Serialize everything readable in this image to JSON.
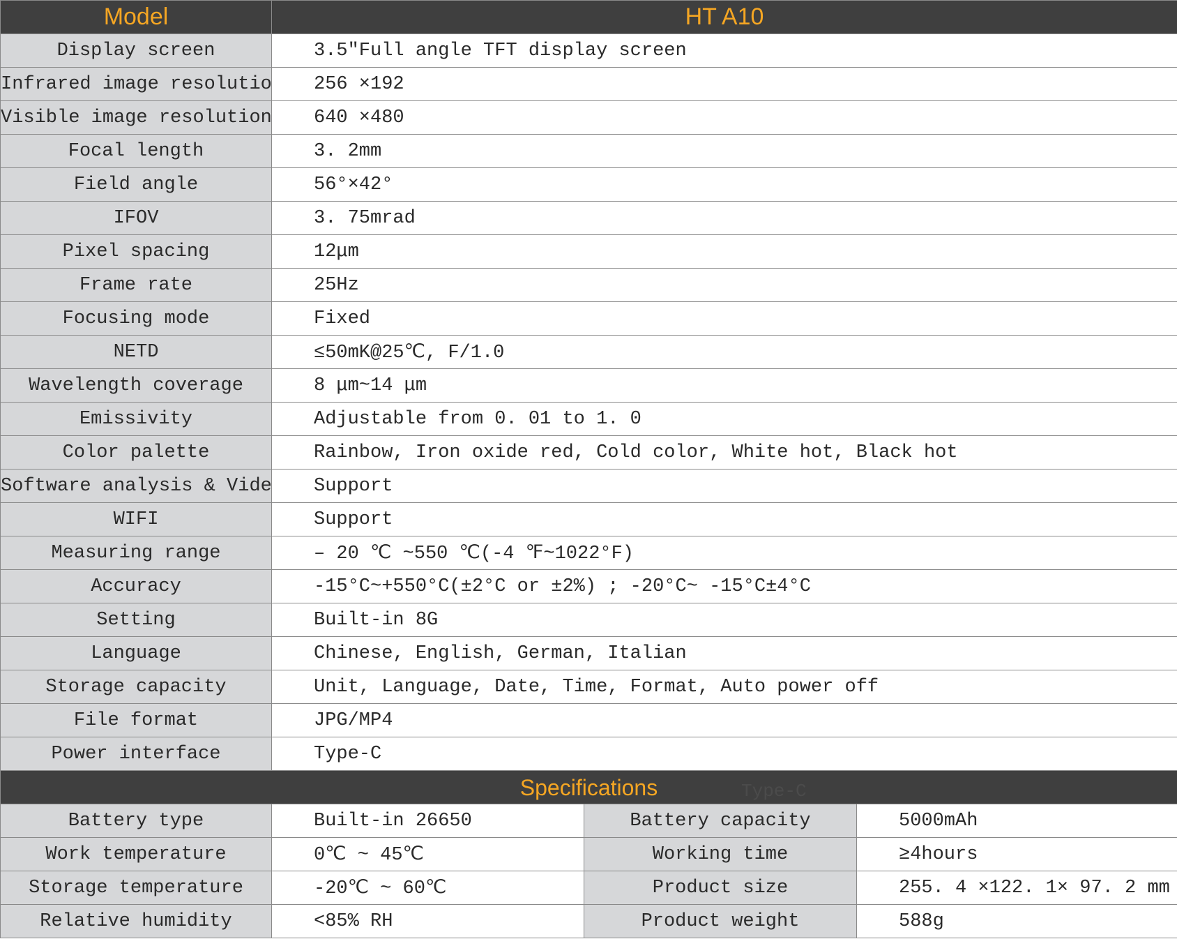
{
  "header": {
    "model_label": "Model",
    "model_value": "HT A10"
  },
  "rows": [
    {
      "label": "Display screen",
      "value": "3.5″Full angle TFT display screen"
    },
    {
      "label": "Infrared image resolution",
      "value": "256 ×192"
    },
    {
      "label": "Visible image resolution",
      "value": "640 ×480"
    },
    {
      "label": "Focal length",
      "value": "3. 2mm"
    },
    {
      "label": "Field angle",
      "value": "56°×42°"
    },
    {
      "label": "IFOV",
      "value": "3. 75mrad"
    },
    {
      "label": "Pixel spacing",
      "value": "12μm"
    },
    {
      "label": "Frame rate",
      "value": "25Hz"
    },
    {
      "label": "Focusing mode",
      "value": "Fixed"
    },
    {
      "label": "NETD",
      "value": "≤50mK@25℃, F/1.0"
    },
    {
      "label": "Wavelength coverage",
      "value": "8 μm~14 μm"
    },
    {
      "label": "Emissivity",
      "value": "Adjustable from 0. 01 to 1. 0"
    },
    {
      "label": "Color palette",
      "value": "Rainbow, Iron oxide red, Cold color, White hot, Black hot"
    },
    {
      "label": "Software analysis & Video",
      "value": "Support"
    },
    {
      "label": "WIFI",
      "value": "Support"
    },
    {
      "label": "Measuring range",
      "value": "– 20 ℃ ~550 ℃(-4 ℉~1022°F)"
    },
    {
      "label": "Accuracy",
      "value": "-15°C~+550°C(±2°C or ±2%) ; -20°C~ -15°C±4°C"
    },
    {
      "label": "Setting",
      "value": "Built-in 8G"
    },
    {
      "label": "Language",
      "value": "Chinese, English, German, Italian"
    },
    {
      "label": "Storage capacity",
      "value": "Unit, Language, Date, Time, Format, Auto power off"
    },
    {
      "label": "File format",
      "value": "JPG/MP4"
    },
    {
      "label": "Power interface",
      "value": "Type-C"
    }
  ],
  "specifications": {
    "title": "Specifications",
    "ghost_text": "Type-C",
    "rows": [
      {
        "l1": "Battery type",
        "v1": "Built-in 26650",
        "l2": "Battery capacity",
        "v2": "5000mAh"
      },
      {
        "l1": "Work temperature",
        "v1": "0℃ ~ 45℃",
        "l2": "Working time",
        "v2": "≥4hours"
      },
      {
        "l1": "Storage temperature",
        "v1": "-20℃ ~ 60℃",
        "l2": "Product size",
        "v2": "255. 4 ×122. 1× 97. 2 mm"
      },
      {
        "l1": "Relative humidity",
        "v1": "<85% RH",
        "l2": "Product weight",
        "v2": "588g"
      }
    ]
  }
}
